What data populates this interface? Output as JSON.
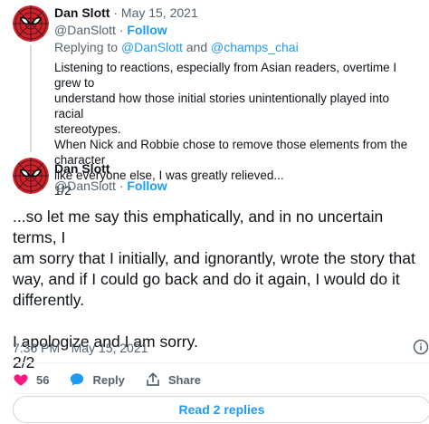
{
  "tweet1": {
    "author_name": "Dan Slott",
    "separator": "·",
    "date": "May 15, 2021",
    "handle": "@DanSlott",
    "follow_label": "Follow",
    "reply_prefix": "Replying to",
    "reply_user1": "@DanSlott",
    "reply_and": "and",
    "reply_user2": "@champs_chai",
    "body_lines": [
      "Listening to reactions, especially from Asian readers, overtime I grew to",
      "understand how those initial stories unintentionally played into racial",
      "stereotypes.",
      "When Nick and Robbie chose to remove those elements from the character",
      "like everyone else, I was greatly relieved...",
      "1/2"
    ]
  },
  "tweet2": {
    "author_name": "Dan Slott",
    "handle": "@DanSlott",
    "follow_label": "Follow",
    "body_lines": [
      "...so let me say this emphatically, and in no uncertain terms, I",
      "am sorry that I initially, and ignorantly, wrote the story that",
      "way, and if I could go back and do it again, I would do it",
      "differently.",
      "",
      "I apologize and I am sorry.",
      "2/2"
    ],
    "timestamp": "7:36 PM · May 15, 2021",
    "like_count": "56",
    "reply_label": "Reply",
    "share_label": "Share",
    "read_replies_label": "Read 2 replies"
  },
  "colors": {
    "accent": "#1d9bf0",
    "like": "#f91880",
    "muted": "#536471"
  },
  "icons": {
    "avatar": "spider-man-mask",
    "like": "heart-icon",
    "reply": "speech-bubble-icon",
    "share": "share-arrow-icon",
    "info": "info-icon"
  }
}
